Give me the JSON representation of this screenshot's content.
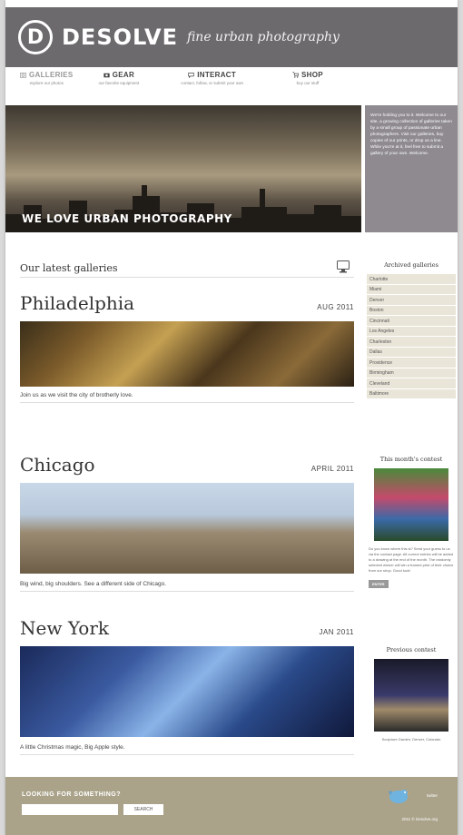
{
  "header": {
    "logo_letter": "D",
    "brand": "DESOLVE",
    "tagline": "fine urban photography"
  },
  "nav": {
    "items": [
      {
        "label": "GALLERIES",
        "sub": "explore our photos",
        "icon": "camera-icon"
      },
      {
        "label": "GEAR",
        "sub": "our favorite equipment",
        "icon": "camera-gear-icon"
      },
      {
        "label": "INTERACT",
        "sub": "contact, follow, or submit your own",
        "icon": "chat-icon"
      },
      {
        "label": "SHOP",
        "sub": "buy our stuff",
        "icon": "cart-icon"
      }
    ]
  },
  "hero": {
    "title": "WE LOVE URBAN PHOTOGRAPHY",
    "side_text": "We're holding you to it. Welcome to our site, a growing collection of galleries taken by a small group of passionate urban photographers. Visit our galleries, buy copies of our prints, or drop us a line. While you're at it, feel free to submit a gallery of your own. Welcome."
  },
  "main": {
    "section_title": "Our latest galleries",
    "galleries": [
      {
        "title": "Philadelphia",
        "date": "AUG 2011",
        "caption": "Join us as we visit the city of brotherly love."
      },
      {
        "title": "Chicago",
        "date": "APRIL 2011",
        "caption": "Big wind, big shoulders. See a different side of Chicago."
      },
      {
        "title": "New York",
        "date": "JAN 2011",
        "caption": "A little Christmas magic, Big Apple style."
      }
    ]
  },
  "sidebar": {
    "archive_title": "Archived galleries",
    "archive": [
      "Charlotte",
      "Miami",
      "Denver",
      "Boston",
      "Cincinnati",
      "Los Angeles",
      "Charleston",
      "Dallas",
      "Providence",
      "Birmingham",
      "Cleveland",
      "Baltimore"
    ],
    "contest_title": "This month's contest",
    "contest_text": "Do you know where this is? Send your guess to us via the contact page. All correct entries will be added to a drawing at the end of the month. The randomly selected winner will win a framed print of their choice from our shop. Good luck!",
    "enter_label": "ENTER",
    "prev_title": "Previous contest",
    "prev_caption": "Sculpture Garden, Denver, Colorado"
  },
  "footer": {
    "label": "LOOKING FOR SOMETHING?",
    "search_placeholder": "",
    "search_button": "SEARCH",
    "twitter": "twitter",
    "copyright": "2011 © Desolve.org"
  }
}
